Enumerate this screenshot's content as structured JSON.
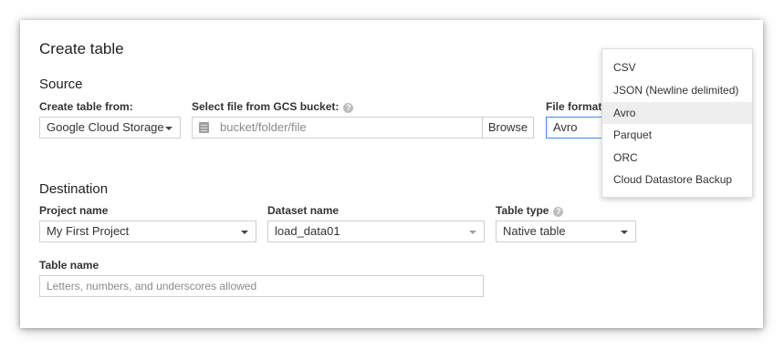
{
  "dialog": {
    "title": "Create table"
  },
  "source": {
    "heading": "Source",
    "create_from_label": "Create table from:",
    "create_from_value": "Google Cloud Storage",
    "gcs_label": "Select file from GCS bucket:",
    "gcs_placeholder": "bucket/folder/file",
    "browse_label": "Browse",
    "file_format_label": "File format:",
    "file_format_value": "Avro"
  },
  "format_menu": {
    "items": [
      "CSV",
      "JSON (Newline delimited)",
      "Avro",
      "Parquet",
      "ORC",
      "Cloud Datastore Backup"
    ],
    "highlighted": "Avro"
  },
  "destination": {
    "heading": "Destination",
    "project_label": "Project name",
    "project_value": "My First Project",
    "dataset_label": "Dataset name",
    "dataset_value": "load_data01",
    "table_type_label": "Table type",
    "table_type_value": "Native table",
    "table_name_label": "Table name",
    "table_name_placeholder": "Letters, numbers, and underscores allowed"
  },
  "icons": {
    "help": "question-mark-circle-icon",
    "file": "file-icon",
    "dropdown": "chevron-down-icon"
  }
}
